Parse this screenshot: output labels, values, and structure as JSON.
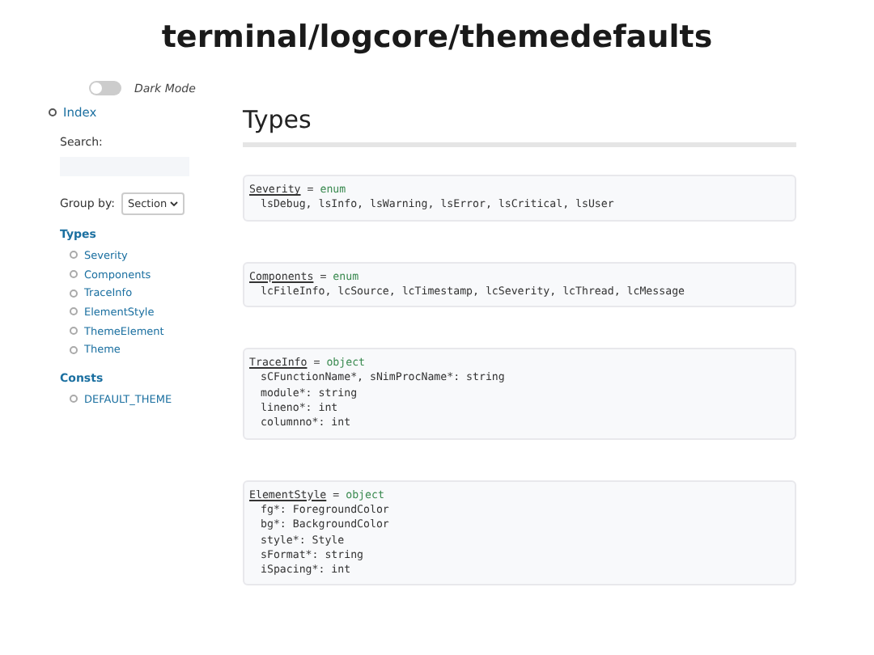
{
  "title": "terminal/logcore/themedefaults",
  "dark_mode": {
    "label": "Dark Mode",
    "on": false
  },
  "index_link": "Index",
  "search": {
    "label": "Search:"
  },
  "group_by": {
    "label": "Group by:",
    "value": "Section"
  },
  "nav_sections": [
    {
      "heading": "Types",
      "items": [
        "Severity",
        "Components",
        "TraceInfo",
        "ElementStyle",
        "ThemeElement",
        "Theme"
      ]
    },
    {
      "heading": "Consts",
      "items": [
        "DEFAULT_THEME"
      ]
    }
  ],
  "section_heading": "Types",
  "declarations": [
    {
      "name": "Severity",
      "operator": "=",
      "keyword": "enum",
      "lines": [
        "lsDebug, lsInfo, lsWarning, lsError, lsCritical, lsUser"
      ]
    },
    {
      "name": "Components",
      "operator": "=",
      "keyword": "enum",
      "lines": [
        "lcFileInfo, lcSource, lcTimestamp, lcSeverity, lcThread, lcMessage"
      ]
    },
    {
      "name": "TraceInfo",
      "operator": "=",
      "keyword": "object",
      "lines": [
        "sCFunctionName*, sNimProcName*: string",
        "module*: string",
        "lineno*: int",
        "columnno*: int"
      ]
    },
    {
      "name": "ElementStyle",
      "operator": "=",
      "keyword": "object",
      "lines": [
        "fg*: ForegroundColor",
        "bg*: BackgroundColor",
        "style*: Style",
        "sFormat*: string",
        "iSpacing*: int"
      ]
    }
  ]
}
